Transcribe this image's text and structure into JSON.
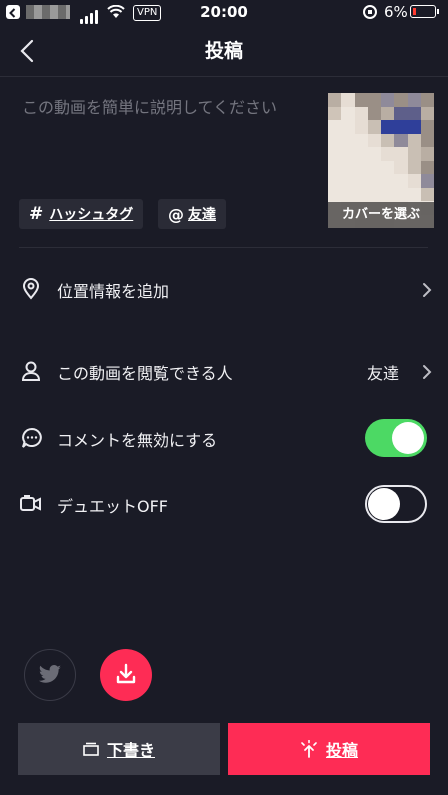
{
  "status_bar": {
    "carrier": "▒▒▒▒▒",
    "vpn": "VPN",
    "time": "20:00",
    "battery": "6%"
  },
  "header": {
    "title": "投稿"
  },
  "description": {
    "placeholder": "この動画を簡単に説明してください"
  },
  "cover": {
    "label": "カバーを選ぶ"
  },
  "chips": {
    "hashtag_label": "ハッシュタグ",
    "friends_label": "友達"
  },
  "settings": {
    "location_label": "位置情報を追加",
    "visibility_label": "この動画を閲覧できる人",
    "visibility_value": "友達",
    "comments_label": "コメントを無効にする",
    "comments_enabled": true,
    "duet_label": "デュエットOFF",
    "duet_enabled": false
  },
  "actions": {
    "draft_label": "下書き",
    "post_label": "投稿"
  },
  "colors": {
    "accent": "#fe2c55",
    "toggle_on": "#4cd964",
    "background": "#1a1b26"
  }
}
